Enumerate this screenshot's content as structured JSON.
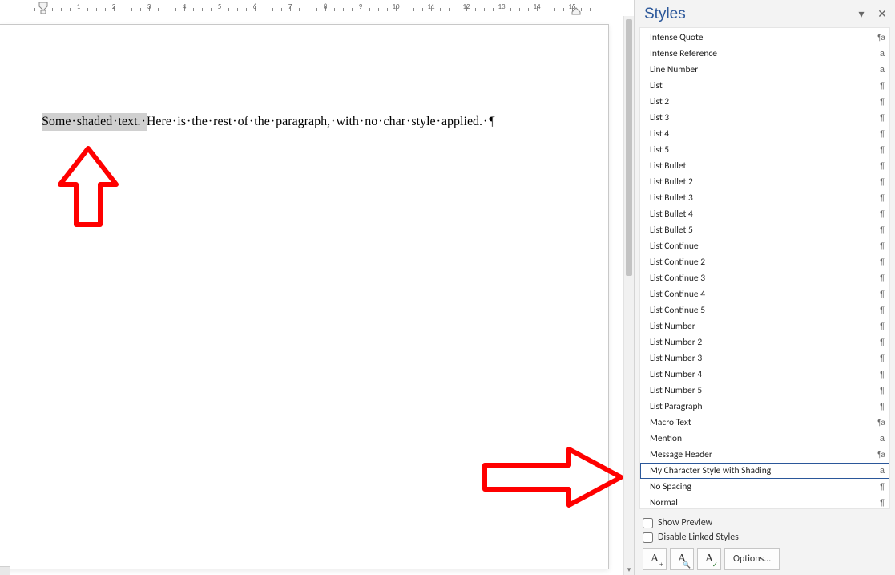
{
  "styles_pane_title": "Styles",
  "document": {
    "shaded_words": [
      "Some",
      "shaded",
      "text."
    ],
    "rest_words": [
      "Here",
      "is",
      "the",
      "rest",
      "of",
      "the",
      "paragraph,",
      "with",
      "no",
      "char",
      "style",
      "applied."
    ]
  },
  "ruler_max": 15,
  "styles": [
    {
      "name": "Intense Quote",
      "type": "linked"
    },
    {
      "name": "Intense Reference",
      "type": "char"
    },
    {
      "name": "Line Number",
      "type": "char"
    },
    {
      "name": "List",
      "type": "para"
    },
    {
      "name": "List 2",
      "type": "para"
    },
    {
      "name": "List 3",
      "type": "para"
    },
    {
      "name": "List 4",
      "type": "para"
    },
    {
      "name": "List 5",
      "type": "para"
    },
    {
      "name": "List Bullet",
      "type": "para"
    },
    {
      "name": "List Bullet 2",
      "type": "para"
    },
    {
      "name": "List Bullet 3",
      "type": "para"
    },
    {
      "name": "List Bullet 4",
      "type": "para"
    },
    {
      "name": "List Bullet 5",
      "type": "para"
    },
    {
      "name": "List Continue",
      "type": "para"
    },
    {
      "name": "List Continue 2",
      "type": "para"
    },
    {
      "name": "List Continue 3",
      "type": "para"
    },
    {
      "name": "List Continue 4",
      "type": "para"
    },
    {
      "name": "List Continue 5",
      "type": "para"
    },
    {
      "name": "List Number",
      "type": "para"
    },
    {
      "name": "List Number 2",
      "type": "para"
    },
    {
      "name": "List Number 3",
      "type": "para"
    },
    {
      "name": "List Number 4",
      "type": "para"
    },
    {
      "name": "List Number 5",
      "type": "para"
    },
    {
      "name": "List Paragraph",
      "type": "para"
    },
    {
      "name": "Macro Text",
      "type": "linked"
    },
    {
      "name": "Mention",
      "type": "char"
    },
    {
      "name": "Message Header",
      "type": "linked"
    },
    {
      "name": "My Character Style with Shading",
      "type": "char",
      "selected": true
    },
    {
      "name": "No Spacing",
      "type": "para"
    },
    {
      "name": "Normal",
      "type": "para"
    }
  ],
  "footer": {
    "show_preview": "Show Preview",
    "disable_linked": "Disable Linked Styles",
    "options": "Options..."
  },
  "icon_buttons": {
    "new_style_sub": "+",
    "inspector_sub": "ᵩ",
    "manage_sub": "✓",
    "letter": "A"
  }
}
